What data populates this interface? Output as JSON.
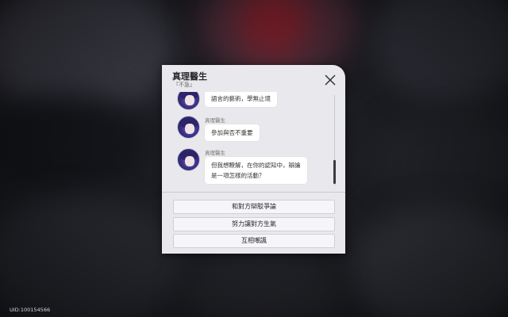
{
  "dialog": {
    "title": "真理醫生",
    "subtitle": "『不急』"
  },
  "messages": [
    {
      "speaker": "",
      "text": "語言的藝術，學無止境"
    },
    {
      "speaker": "真理醫生",
      "text": "參加與否不重要"
    },
    {
      "speaker": "真理醫生",
      "text_lines": [
        "但我想瞭解，在你的認知中，辯論",
        "是一項怎樣的活動？"
      ]
    }
  ],
  "options": [
    {
      "label": "和對方辯駁爭論"
    },
    {
      "label": "努力讓對方生氣"
    },
    {
      "label": "互相嘲諷"
    }
  ],
  "footer": {
    "uid": "UID:100154566"
  },
  "colors": {
    "panel_bg": "#e9e9ed",
    "bubble_bg": "#ffffff",
    "option_bg": "#f6f6f8"
  },
  "icons": {
    "close": "close-icon",
    "avatar": "dr-ratio-avatar"
  }
}
